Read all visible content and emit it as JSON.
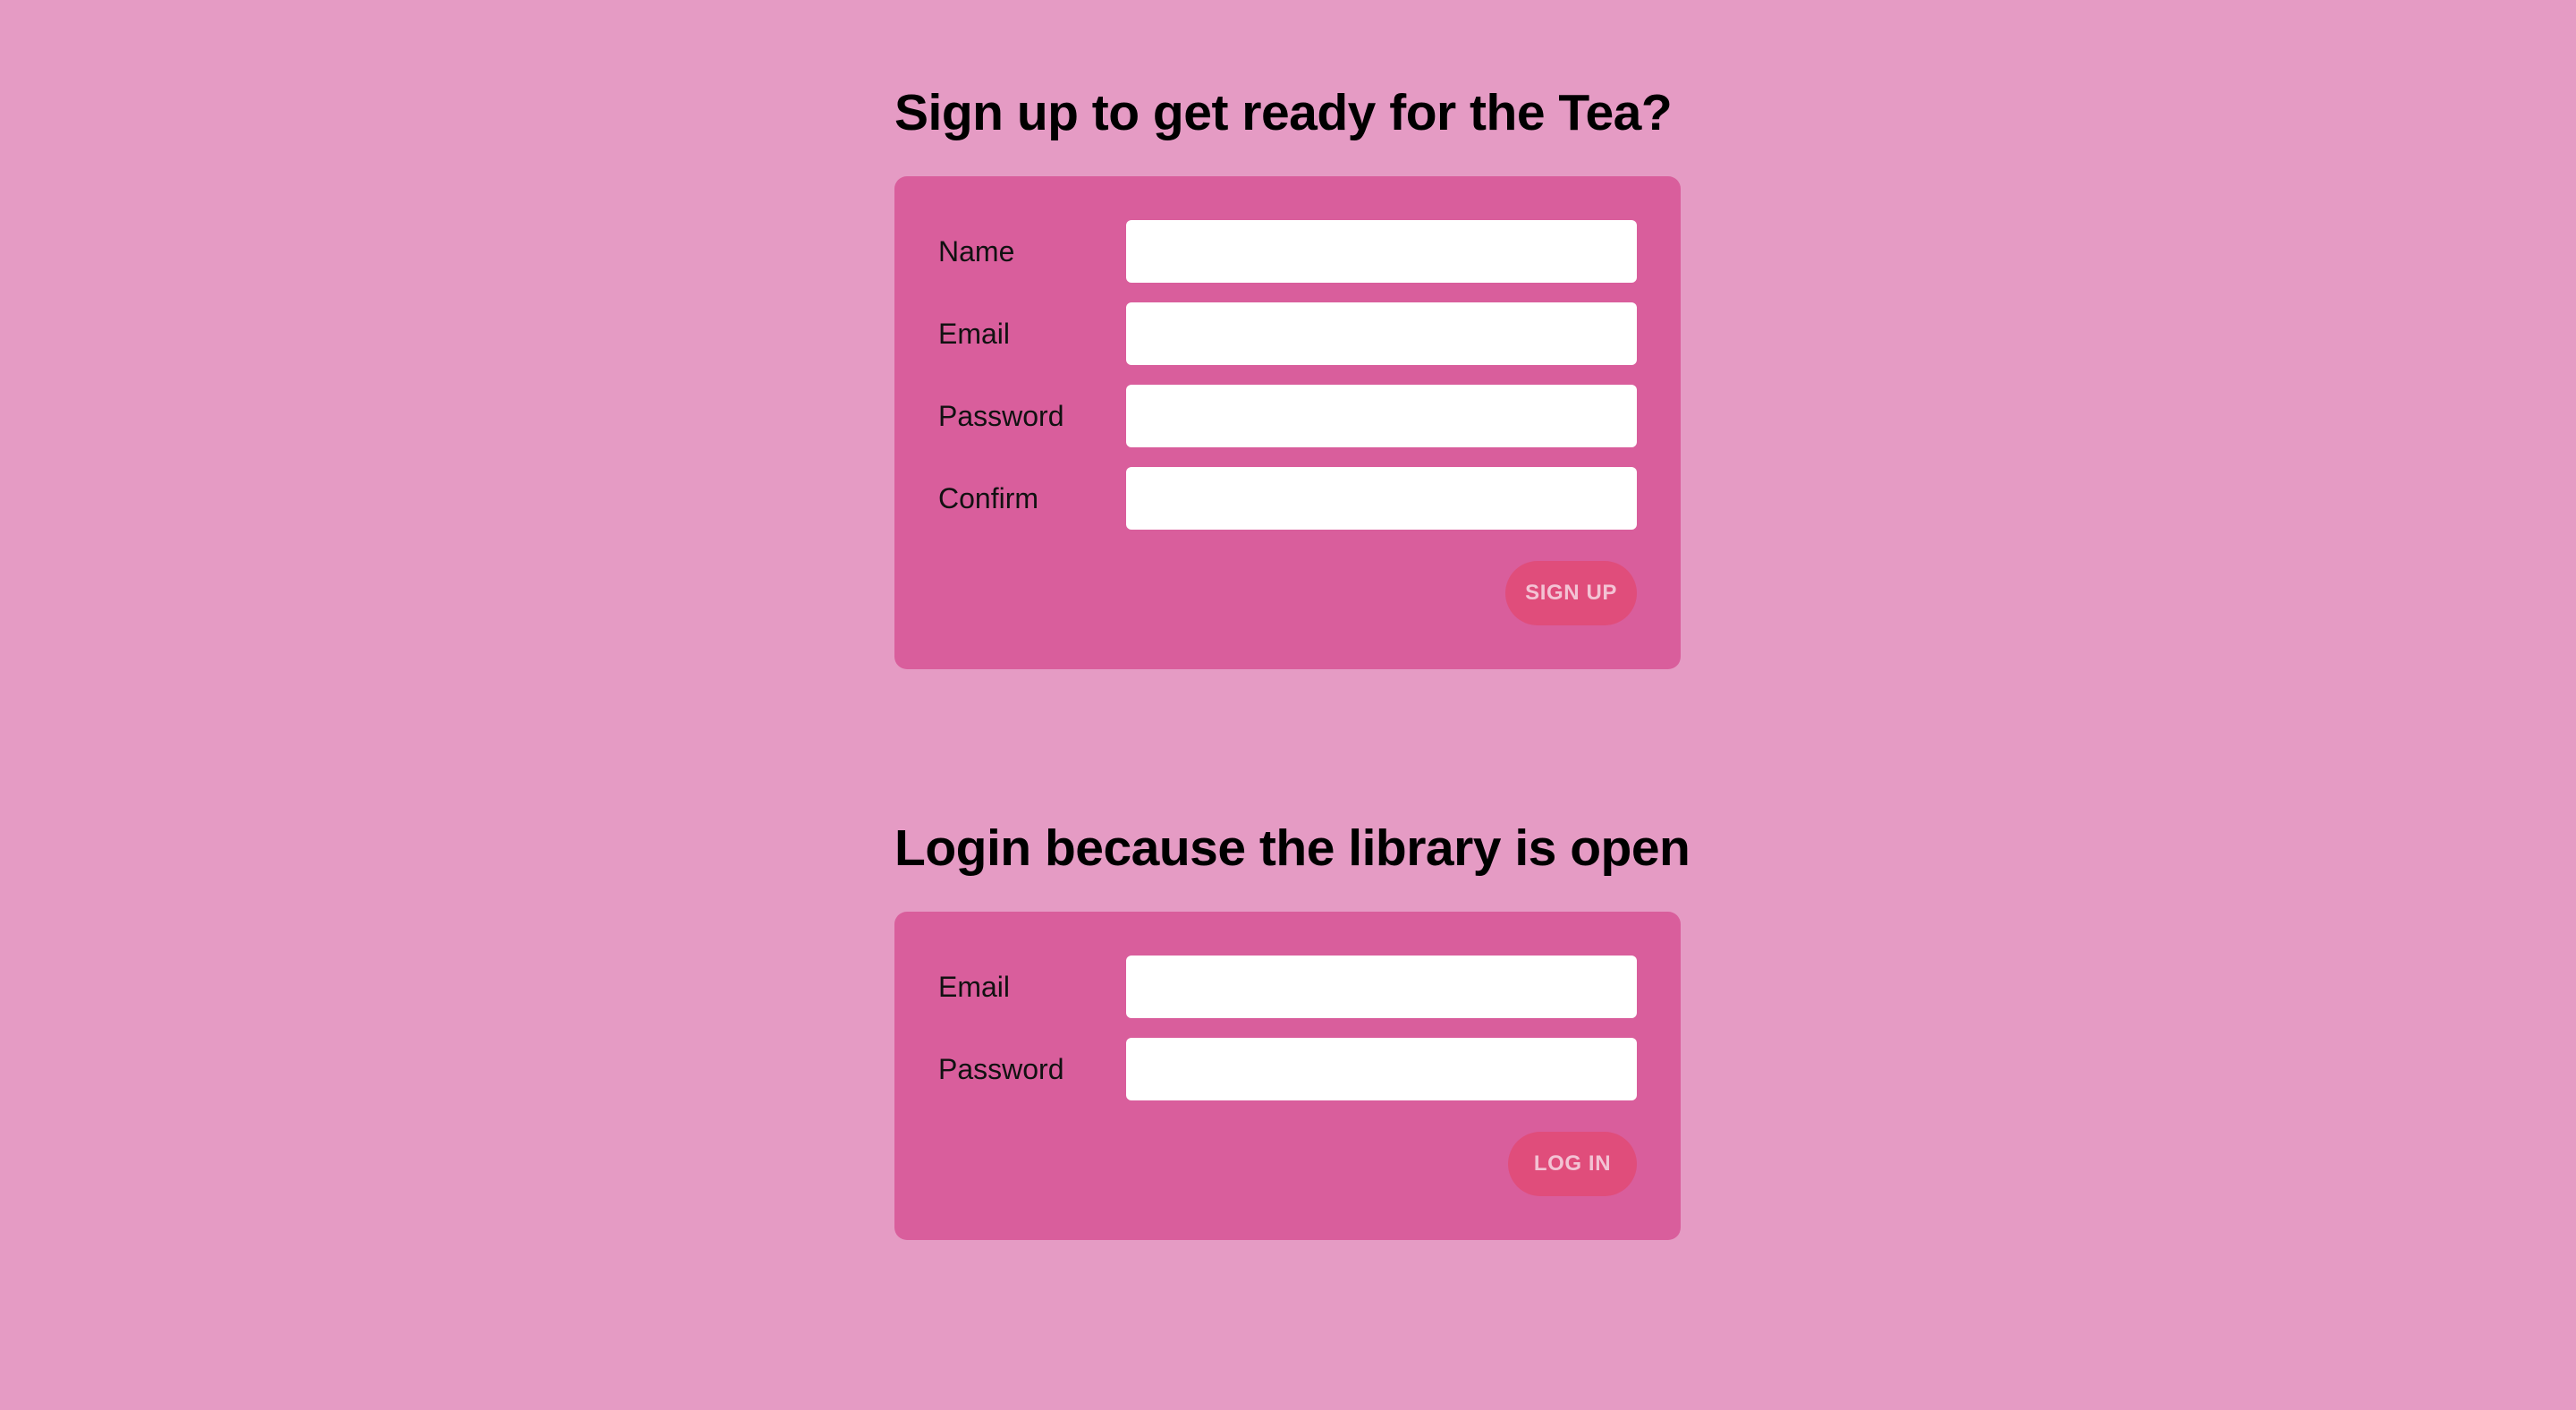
{
  "signup": {
    "title": "Sign up to get ready for the Tea?",
    "fields": [
      {
        "label": "Name",
        "value": ""
      },
      {
        "label": "Email",
        "value": ""
      },
      {
        "label": "Password",
        "value": ""
      },
      {
        "label": "Confirm",
        "value": ""
      }
    ],
    "button_label": "SIGN UP"
  },
  "login": {
    "title": "Login because the library is open",
    "fields": [
      {
        "label": "Email",
        "value": ""
      },
      {
        "label": "Password",
        "value": ""
      }
    ],
    "button_label": "LOG IN"
  },
  "colors": {
    "page_background": "#e59bc4",
    "card_background": "#d95e9c",
    "button_background": "#e04d7b",
    "button_text": "#f3c3d4",
    "input_background": "#ffffff"
  }
}
